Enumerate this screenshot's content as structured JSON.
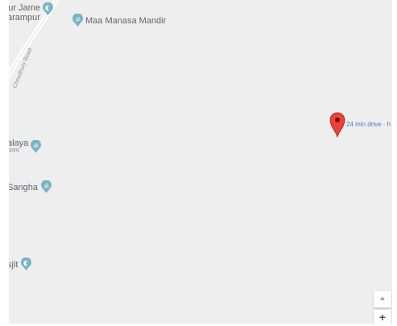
{
  "map": {
    "pois": [
      {
        "id": "masjid-jame",
        "label": "ur Jame",
        "sub": "arampur"
      },
      {
        "id": "maa-manasa",
        "label": "Maa Manasa Mandir",
        "sub": ""
      },
      {
        "id": "vidyalaya",
        "label": "alaya",
        "sub": "यालय"
      },
      {
        "id": "sangha",
        "label": "Sangha",
        "sub": ""
      },
      {
        "id": "masjid",
        "label": "sjit",
        "sub": ""
      }
    ],
    "road_label": "Choudhury Road",
    "marker": {
      "label": "24 min drive · h"
    },
    "controls": {
      "locate": "⌖",
      "zoom_in": "+"
    }
  },
  "colors": {
    "background": "#eeeeee",
    "road": "#ffffff",
    "poi_teal": "#7bb3c4",
    "marker_red": "#ea4335",
    "marker_text": "#4a7bd0"
  }
}
